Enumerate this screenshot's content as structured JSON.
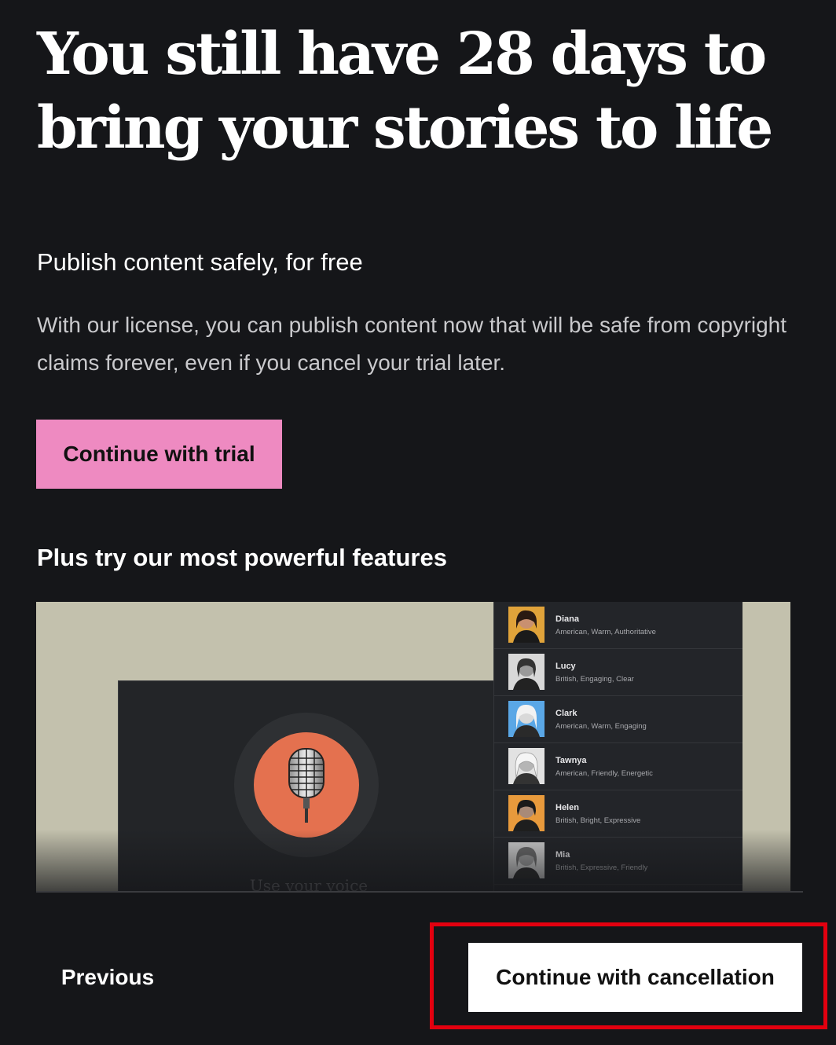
{
  "headline": "You still have 28 days to bring your stories to life",
  "subhead": "Publish content safely, for free",
  "body": "With our license, you can publish content now that will be safe from copyright claims forever, even if you cancel your trial later.",
  "trial_button": "Continue with trial",
  "features_title": "Plus try our most powerful features",
  "preview": {
    "caption": "Use your voice",
    "mic_icon": "microphone-icon",
    "voices": [
      {
        "name": "Diana",
        "desc": "American, Warm, Authoritative",
        "color": "#e0a33a"
      },
      {
        "name": "Lucy",
        "desc": "British, Engaging, Clear",
        "color": "#d8d8d8"
      },
      {
        "name": "Clark",
        "desc": "American, Warm, Engaging",
        "color": "#5aa7e6"
      },
      {
        "name": "Tawnya",
        "desc": "American, Friendly, Energetic",
        "color": "#e2e2e2"
      },
      {
        "name": "Helen",
        "desc": "British, Bright, Expressive",
        "color": "#e89a3c"
      },
      {
        "name": "Mia",
        "desc": "British, Expressive, Friendly",
        "color": "#cfcfcf"
      }
    ]
  },
  "footer": {
    "previous_label": "Previous",
    "cancel_label": "Continue with cancellation"
  },
  "colors": {
    "background": "#151619",
    "trial_button": "#ee8ac1",
    "highlight": "#e3000f",
    "mic_circle": "#e4714f"
  }
}
